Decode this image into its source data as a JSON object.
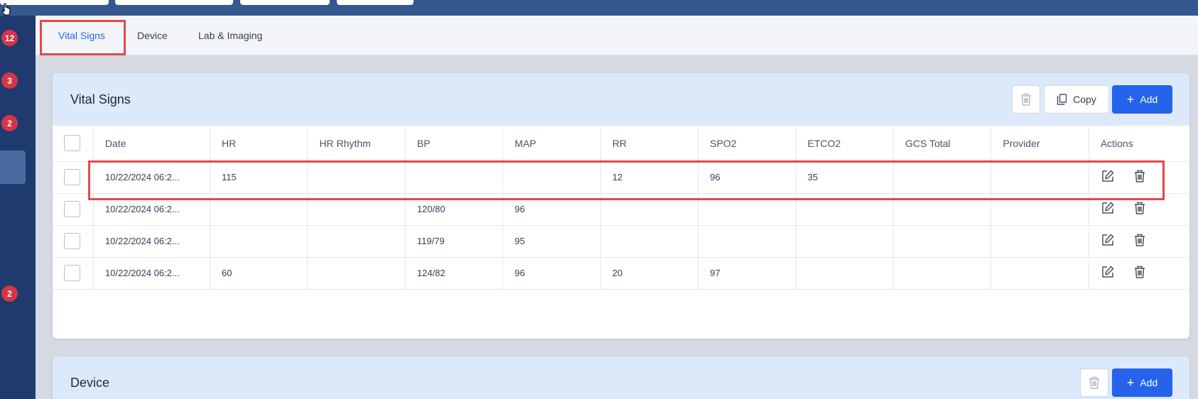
{
  "tabs": [
    {
      "label": "Vital Signs",
      "active": true
    },
    {
      "label": "Device",
      "active": false
    },
    {
      "label": "Lab & Imaging",
      "active": false
    }
  ],
  "sidebar": {
    "badges": [
      "12",
      "3",
      "2",
      "2"
    ]
  },
  "vitals": {
    "title": "Vital Signs",
    "copy_label": "Copy",
    "add_label": "Add",
    "columns": [
      "Date",
      "HR",
      "HR Rhythm",
      "BP",
      "MAP",
      "RR",
      "SPO2",
      "ETCO2",
      "GCS Total",
      "Provider",
      "Actions"
    ],
    "rows": [
      {
        "date": "10/22/2024 06:2...",
        "hr": "115",
        "hr_rhythm": "",
        "bp": "",
        "map": "",
        "rr": "12",
        "spo2": "96",
        "etco2": "35",
        "gcs": "",
        "provider": ""
      },
      {
        "date": "10/22/2024 06:2...",
        "hr": "",
        "hr_rhythm": "",
        "bp": "120/80",
        "map": "96",
        "rr": "",
        "spo2": "",
        "etco2": "",
        "gcs": "",
        "provider": ""
      },
      {
        "date": "10/22/2024 06:2...",
        "hr": "",
        "hr_rhythm": "",
        "bp": "119/79",
        "map": "95",
        "rr": "",
        "spo2": "",
        "etco2": "",
        "gcs": "",
        "provider": ""
      },
      {
        "date": "10/22/2024 06:2...",
        "hr": "60",
        "hr_rhythm": "",
        "bp": "124/82",
        "map": "96",
        "rr": "20",
        "spo2": "97",
        "etco2": "",
        "gcs": "",
        "provider": ""
      }
    ]
  },
  "device": {
    "title": "Device",
    "add_label": "Add"
  },
  "colors": {
    "accent": "#2563eb",
    "highlight": "#e5484d",
    "sidebar": "#1f3a6e",
    "badge": "#d63447"
  }
}
